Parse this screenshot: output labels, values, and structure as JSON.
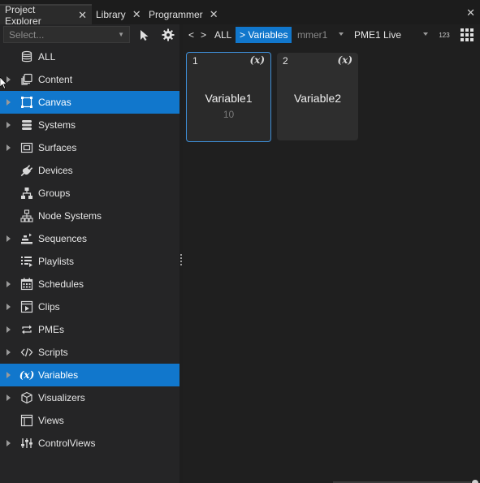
{
  "tabs": [
    {
      "label": "Project Explorer",
      "active": true
    },
    {
      "label": "Library",
      "active": false
    },
    {
      "label": "Programmer",
      "active": false
    }
  ],
  "tab_close_glyph": "✕",
  "left_toolbar": {
    "select_placeholder": "Select...",
    "pointer_icon": "pointer-icon",
    "settings_icon": "gear-icon"
  },
  "tree": [
    {
      "label": "ALL",
      "icon": "database-icon",
      "expandable": false,
      "selected": false
    },
    {
      "label": "Content",
      "icon": "content-icon",
      "expandable": true,
      "selected": false
    },
    {
      "label": "Canvas",
      "icon": "canvas-icon",
      "expandable": true,
      "selected": true
    },
    {
      "label": "Systems",
      "icon": "systems-icon",
      "expandable": true,
      "selected": false
    },
    {
      "label": "Surfaces",
      "icon": "surfaces-icon",
      "expandable": true,
      "selected": false
    },
    {
      "label": "Devices",
      "icon": "plug-icon",
      "expandable": false,
      "selected": false
    },
    {
      "label": "Groups",
      "icon": "groups-icon",
      "expandable": false,
      "selected": false
    },
    {
      "label": "Node Systems",
      "icon": "node-systems-icon",
      "expandable": false,
      "selected": false
    },
    {
      "label": "Sequences",
      "icon": "sequences-icon",
      "expandable": true,
      "selected": false
    },
    {
      "label": "Playlists",
      "icon": "playlist-icon",
      "expandable": false,
      "selected": false
    },
    {
      "label": "Schedules",
      "icon": "calendar-icon",
      "expandable": true,
      "selected": false
    },
    {
      "label": "Clips",
      "icon": "clips-icon",
      "expandable": true,
      "selected": false
    },
    {
      "label": "PMEs",
      "icon": "pme-icon",
      "expandable": true,
      "selected": false
    },
    {
      "label": "Scripts",
      "icon": "code-icon",
      "expandable": true,
      "selected": false
    },
    {
      "label": "Variables",
      "icon": "variable-icon",
      "expandable": true,
      "selected": true
    },
    {
      "label": "Visualizers",
      "icon": "cube-icon",
      "expandable": true,
      "selected": false
    },
    {
      "label": "Views",
      "icon": "views-icon",
      "expandable": false,
      "selected": false
    },
    {
      "label": "ControlViews",
      "icon": "sliders-icon",
      "expandable": true,
      "selected": false
    }
  ],
  "breadcrumb": {
    "back": "<",
    "forward": ">",
    "all": "ALL",
    "current": "> Variables",
    "programmer": "mmer1",
    "pme": "PME1 Live",
    "number_mode": "123"
  },
  "cards": [
    {
      "number": "1",
      "type_symbol": "(x)",
      "name": "Variable1",
      "value": "10",
      "selected": true
    },
    {
      "number": "2",
      "type_symbol": "(x)",
      "name": "Variable2",
      "value": "",
      "selected": false
    }
  ],
  "colors": {
    "accent": "#1177cc",
    "panel": "#252526",
    "background": "#1a1a1a"
  }
}
